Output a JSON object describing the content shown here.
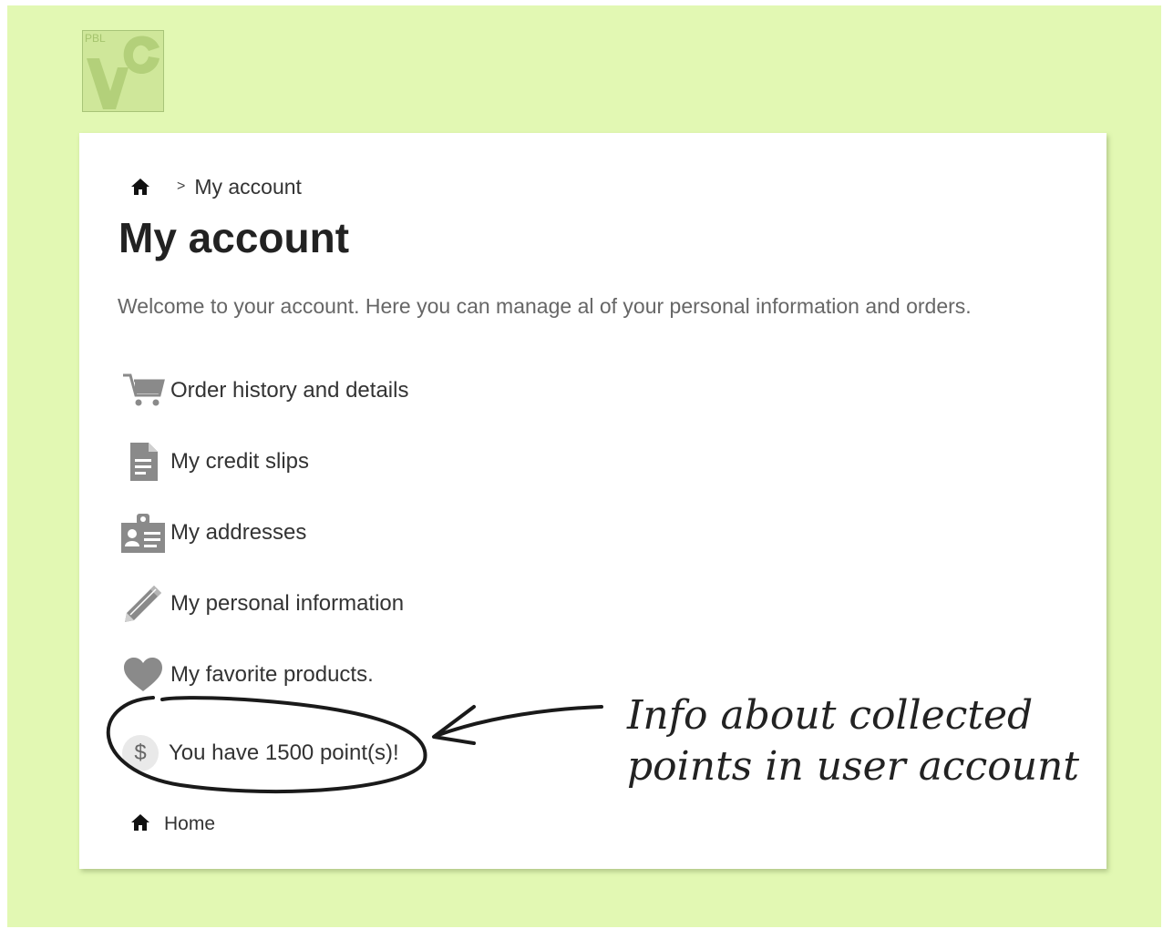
{
  "logo": {
    "text": "PBL",
    "alt": "site-logo"
  },
  "breadcrumb": {
    "separator": ">",
    "current": "My account"
  },
  "page": {
    "title": "My account",
    "welcome": "Welcome to your account. Here you can manage al of your personal information and orders."
  },
  "menu": {
    "items": [
      {
        "label": "Order history and details",
        "icon": "cart-icon"
      },
      {
        "label": "My credit slips",
        "icon": "document-icon"
      },
      {
        "label": "My addresses",
        "icon": "address-card-icon"
      },
      {
        "label": "My personal information",
        "icon": "pencil-icon"
      },
      {
        "label": "My favorite products.",
        "icon": "heart-icon"
      }
    ],
    "points": {
      "symbol": "$",
      "label": "You have 1500 point(s)!"
    }
  },
  "footer": {
    "home_label": "Home"
  },
  "annotation": {
    "line1": "Info about collected",
    "line2": "points in user account"
  },
  "colors": {
    "background": "#e2f8b3",
    "panel": "#ffffff",
    "text": "#333333",
    "icon": "#8a8a8a"
  }
}
